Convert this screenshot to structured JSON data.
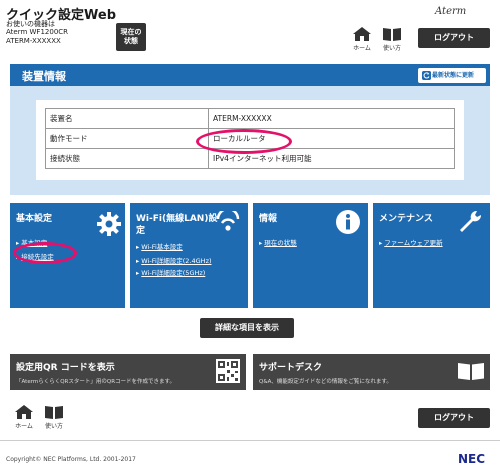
{
  "header": {
    "app_title": "クイック設定Web",
    "device_prefix": "お使いの機器は",
    "device_model": "Aterm WF1200CR",
    "device_name": "ATERM-XXXXXX",
    "current_status_label_1": "現在の",
    "current_status_label_2": "状態",
    "brand": "Aterm",
    "home_label": "ホーム",
    "manual_label": "使い方",
    "logout_label": "ログアウト"
  },
  "device_info": {
    "title": "装置情報",
    "refresh_label": "最新状態に更新",
    "rows": [
      {
        "key": "装置名",
        "value": "ATERM-XXXXXX"
      },
      {
        "key": "動作モード",
        "value": "ローカルルータ"
      },
      {
        "key": "接続状態",
        "value": "IPv4インターネット利用可能"
      }
    ]
  },
  "tiles": {
    "basic": {
      "title": "基本設定",
      "links": [
        "基本設定",
        "接続先設定"
      ]
    },
    "wifi": {
      "title_1": "Wi-Fi(無線LAN)設",
      "title_2": "定",
      "links": [
        "Wi-Fi基本設定",
        "Wi-Fi詳細設定(2.4GHz)",
        "Wi-Fi詳細設定(5GHz)"
      ]
    },
    "info": {
      "title": "情報",
      "links": [
        "現在の状態"
      ]
    },
    "maintenance": {
      "title": "メンテナンス",
      "links": [
        "ファームウェア更新"
      ]
    }
  },
  "detail_button": "詳細な項目を表示",
  "qr_card": {
    "title": "設定用QR コードを表示",
    "subtitle": "「AtermらくらくQRスタート」用のQRコードを作成できます。"
  },
  "support_card": {
    "title": "サポートデスク",
    "subtitle": "Q&A、機能設定ガイドなどの情報をご覧になれます。"
  },
  "footer": {
    "home_label": "ホーム",
    "manual_label": "使い方",
    "logout_label": "ログアウト",
    "copyright": "Copyright© NEC Platforms, Ltd. 2001-2017",
    "logo": "NEC"
  },
  "colors": {
    "primary": "#1f6bb2",
    "highlight": "#e5106a",
    "panel": "#cfe3f4",
    "dark": "#333333"
  }
}
